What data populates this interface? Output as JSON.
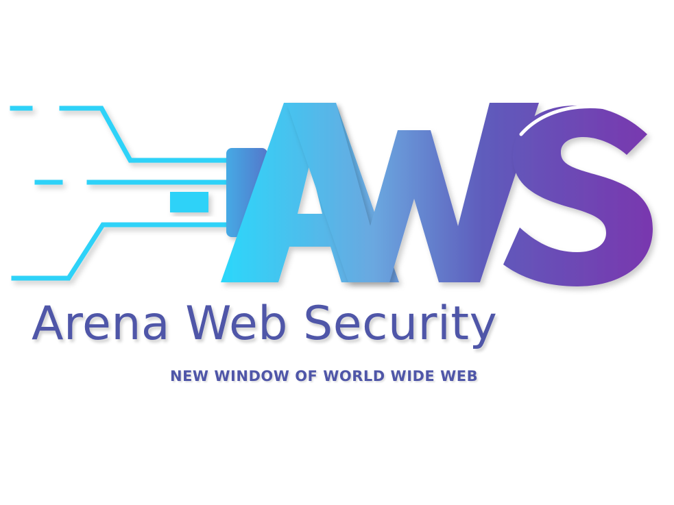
{
  "logo": {
    "monogram": "AWS",
    "brand_name": "Arena Web Security",
    "tagline": "NEW WINDOW OF WORLD WIDE WEB",
    "icon": "circuit-plug-icon"
  },
  "colors": {
    "gradient_start": "#2ad8fb",
    "gradient_mid": "#6a86d6",
    "gradient_end": "#7a36ae",
    "text": "#4f56a8",
    "background": "#ffffff"
  }
}
